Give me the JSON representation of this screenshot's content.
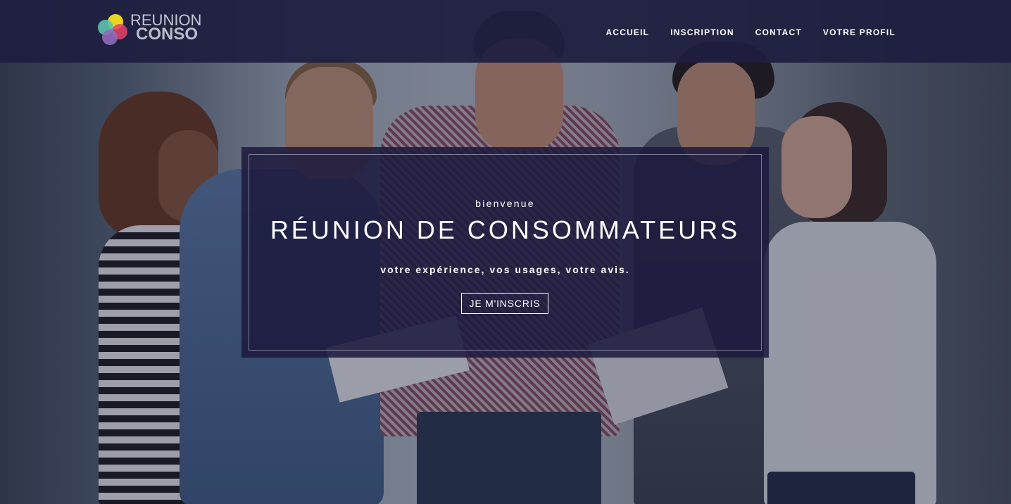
{
  "brand": {
    "name_top": "REUNION",
    "name_bottom": "CONSO",
    "logo_colors": [
      "#f2e21f",
      "#e8416b",
      "#5bc3b0",
      "#8e6bb8"
    ]
  },
  "nav": {
    "items": [
      {
        "label": "ACCUEIL"
      },
      {
        "label": "INSCRIPTION"
      },
      {
        "label": "CONTACT"
      },
      {
        "label": "VOTRE PROFIL"
      }
    ]
  },
  "hero": {
    "kicker": "bienvenue",
    "title": "RÉUNION DE CONSOMMATEURS",
    "subtitle": "votre expérience, vos usages, votre avis.",
    "cta_label": "JE M'INSCRIS"
  },
  "colors": {
    "header_bg": "#1e1e40",
    "card_bg": "#1c1a3e",
    "text": "#ffffff"
  }
}
